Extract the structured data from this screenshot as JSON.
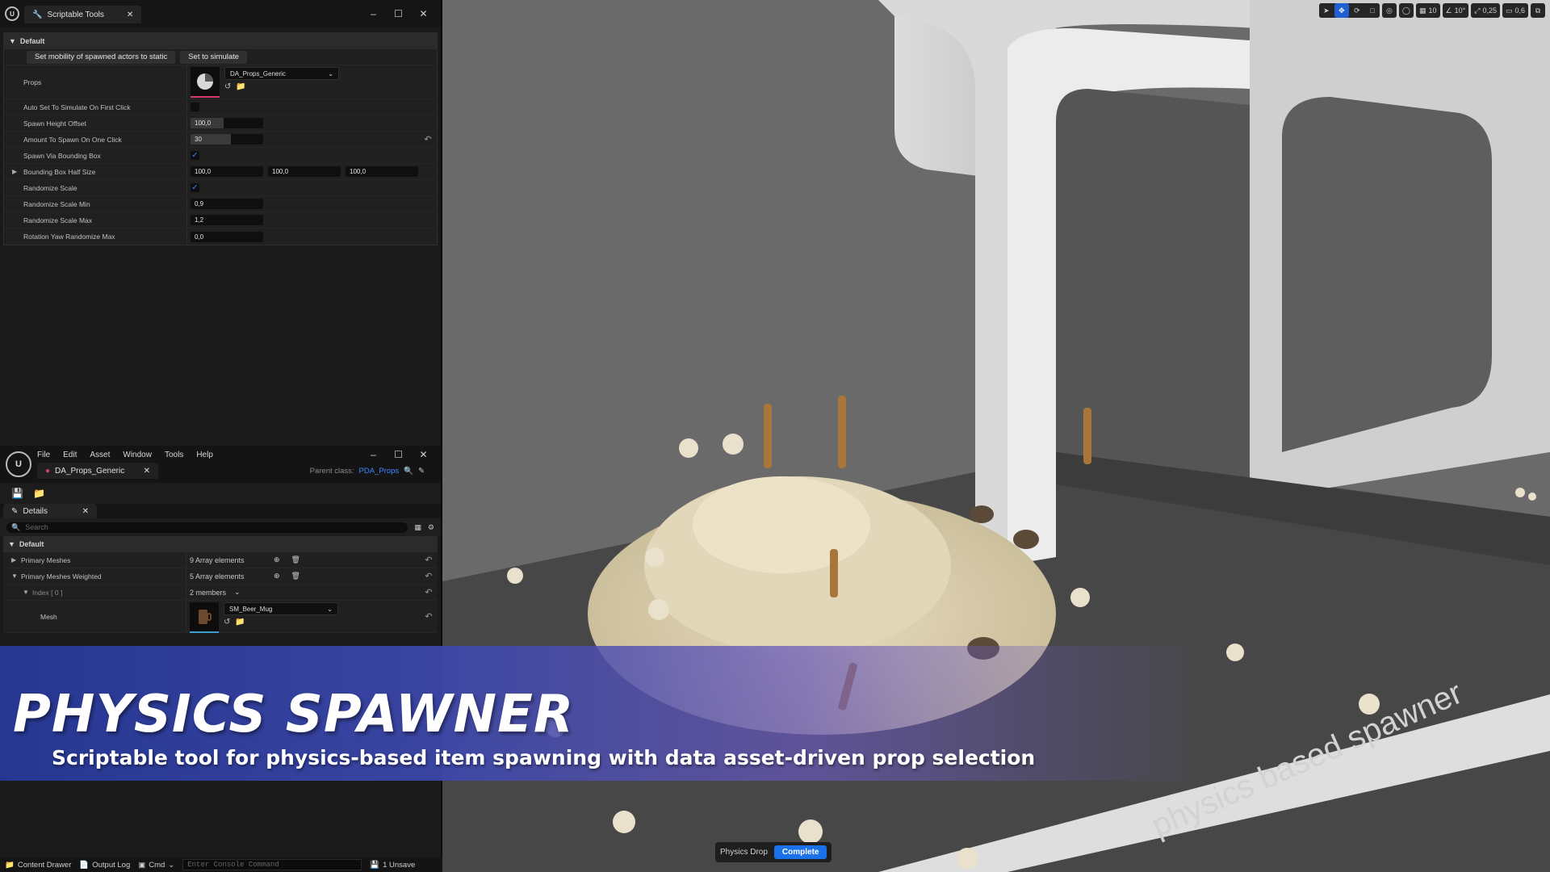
{
  "scriptable_tools": {
    "tab_title": "Scriptable Tools",
    "category": "Default",
    "buttons": [
      "Set mobility of spawned actors to static",
      "Set to simulate"
    ],
    "props_label": "Props",
    "props_asset": "DA_Props_Generic",
    "rows": {
      "auto_simulate": {
        "label": "Auto Set To Simulate On First Click",
        "checked": false
      },
      "spawn_height": {
        "label": "Spawn Height Offset",
        "value": "100,0",
        "slider": 0.45
      },
      "amount": {
        "label": "Amount To Spawn On One Click",
        "value": "30",
        "slider": 0.55
      },
      "via_bbox": {
        "label": "Spawn Via Bounding Box",
        "checked": true
      },
      "bbox_half": {
        "label": "Bounding Box Half Size",
        "x": "100,0",
        "y": "100,0",
        "z": "100,0"
      },
      "randomize_scale": {
        "label": "Randomize Scale",
        "checked": true
      },
      "scale_min": {
        "label": "Randomize Scale Min",
        "value": "0,9"
      },
      "scale_max": {
        "label": "Randomize Scale Max",
        "value": "1,2"
      },
      "yaw_max": {
        "label": "Rotation Yaw Randomize Max",
        "value": "0,0"
      }
    }
  },
  "asset_editor": {
    "menu": [
      "File",
      "Edit",
      "Asset",
      "Window",
      "Tools",
      "Help"
    ],
    "asset_tab": "DA_Props_Generic",
    "parent_class_label": "Parent class:",
    "parent_class": "PDA_Props",
    "details_tab": "Details",
    "search_placeholder": "Search",
    "category": "Default",
    "primary_meshes": {
      "label": "Primary Meshes",
      "value": "9 Array elements"
    },
    "primary_meshes_weighted": {
      "label": "Primary Meshes Weighted",
      "value": "5 Array elements"
    },
    "index0": {
      "label": "Index [ 0 ]",
      "value": "2 members"
    },
    "mesh": {
      "label": "Mesh",
      "asset": "SM_Beer_Mug"
    }
  },
  "viewport": {
    "toolbar": {
      "grid": "10",
      "angle": "10°",
      "scale": "0,25",
      "camera_speed": "0,6"
    },
    "physics_drop_label": "Physics Drop",
    "physics_drop_status": "Complete",
    "floor_text": "physics based spawner"
  },
  "banner": {
    "title": "PHYSICS SPAWNER",
    "subtitle": "Scriptable tool for physics-based item spawning with data asset-driven prop selection"
  },
  "statusbar": {
    "content_drawer": "Content Drawer",
    "output_log": "Output Log",
    "cmd": "Cmd",
    "console_placeholder": "Enter Console Command",
    "unsaved": "1 Unsave"
  }
}
